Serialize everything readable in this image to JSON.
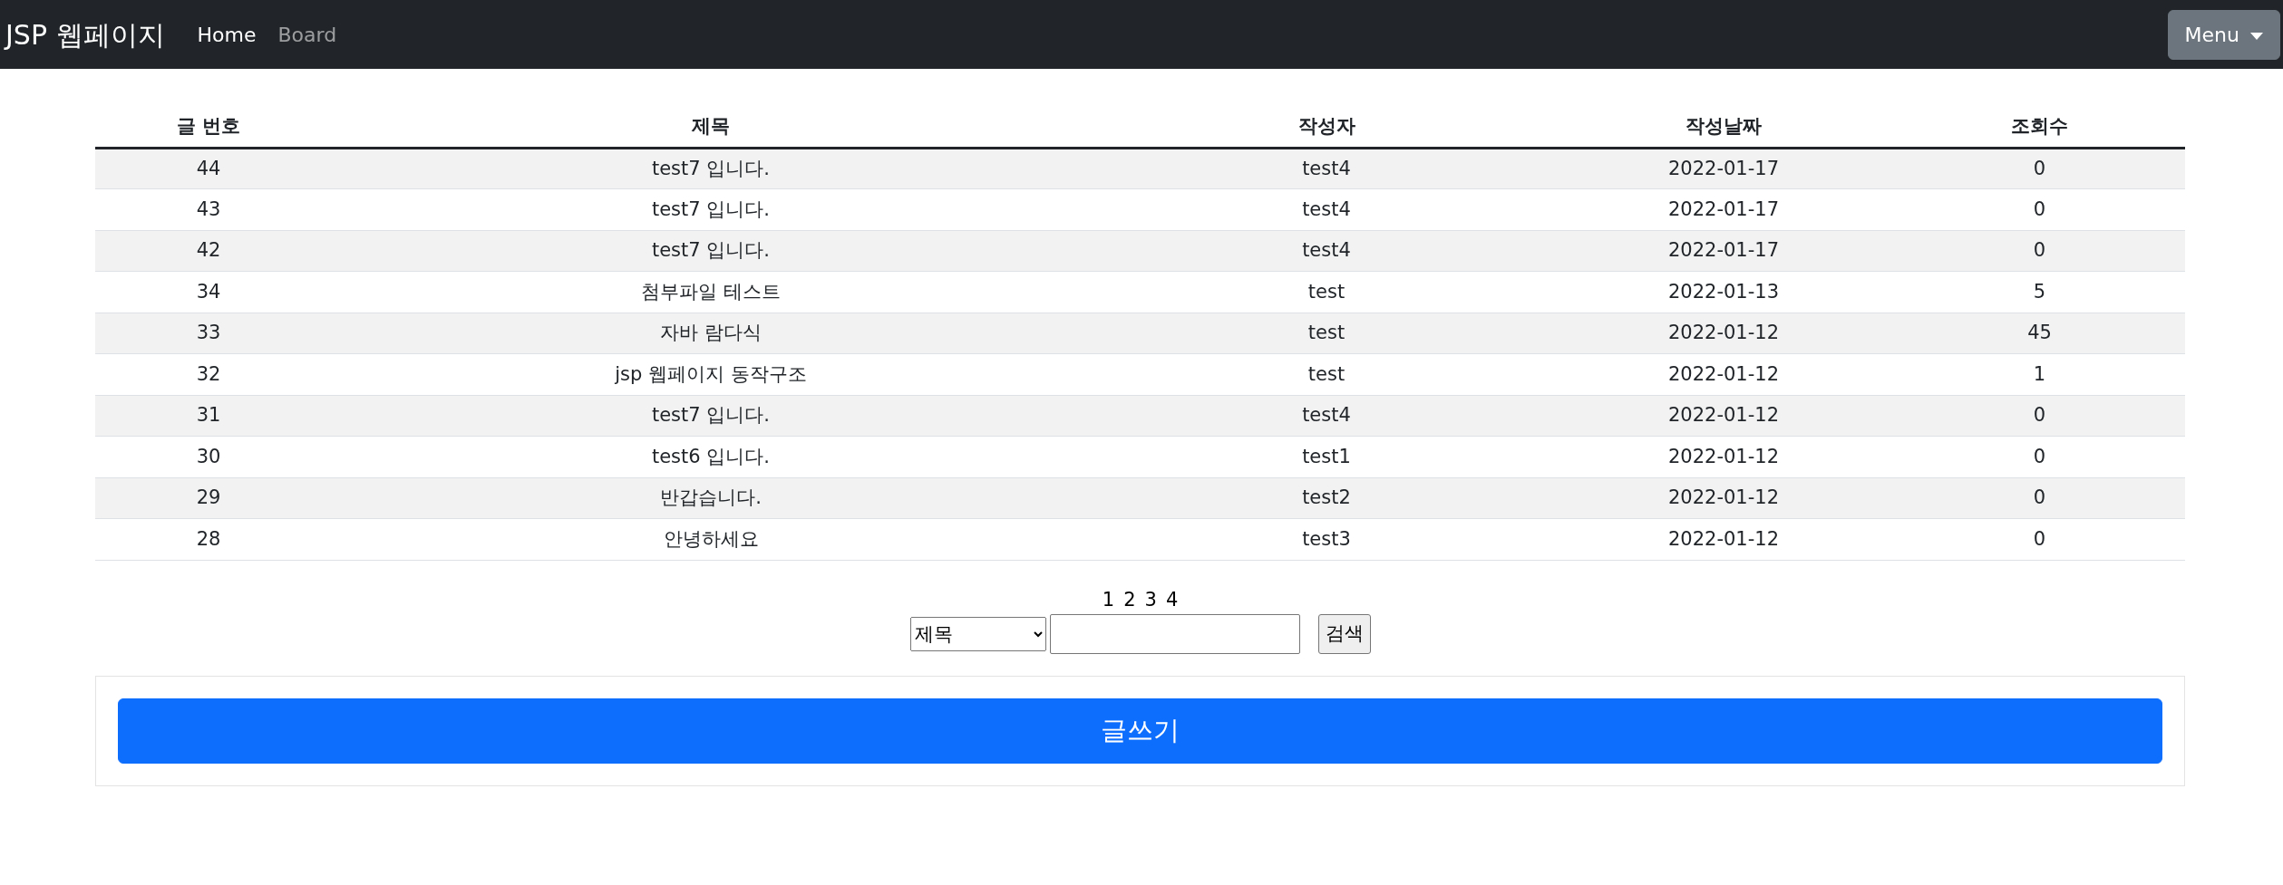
{
  "navbar": {
    "brand": "JSP 웹페이지",
    "links": [
      {
        "label": "Home",
        "selected": true
      },
      {
        "label": "Board",
        "selected": false
      }
    ],
    "menu_button": "Menu"
  },
  "table": {
    "columns": [
      "글 번호",
      "제목",
      "작성자",
      "작성날짜",
      "조회수"
    ],
    "rows": [
      [
        "44",
        "test7 입니다.",
        "test4",
        "2022-01-17",
        "0"
      ],
      [
        "43",
        "test7 입니다.",
        "test4",
        "2022-01-17",
        "0"
      ],
      [
        "42",
        "test7 입니다.",
        "test4",
        "2022-01-17",
        "0"
      ],
      [
        "34",
        "첨부파일 테스트",
        "test",
        "2022-01-13",
        "5"
      ],
      [
        "33",
        "자바 람다식",
        "test",
        "2022-01-12",
        "45"
      ],
      [
        "32",
        "jsp 웹페이지 동작구조",
        "test",
        "2022-01-12",
        "1"
      ],
      [
        "31",
        "test7 입니다.",
        "test4",
        "2022-01-12",
        "0"
      ],
      [
        "30",
        "test6 입니다.",
        "test1",
        "2022-01-12",
        "0"
      ],
      [
        "29",
        "반갑습니다.",
        "test2",
        "2022-01-12",
        "0"
      ],
      [
        "28",
        "안녕하세요",
        "test3",
        "2022-01-12",
        "0"
      ]
    ]
  },
  "pagination": [
    "1",
    "2",
    "3",
    "4"
  ],
  "search": {
    "field_select": "제목",
    "button": "검색"
  },
  "write_button": "글쓰기"
}
